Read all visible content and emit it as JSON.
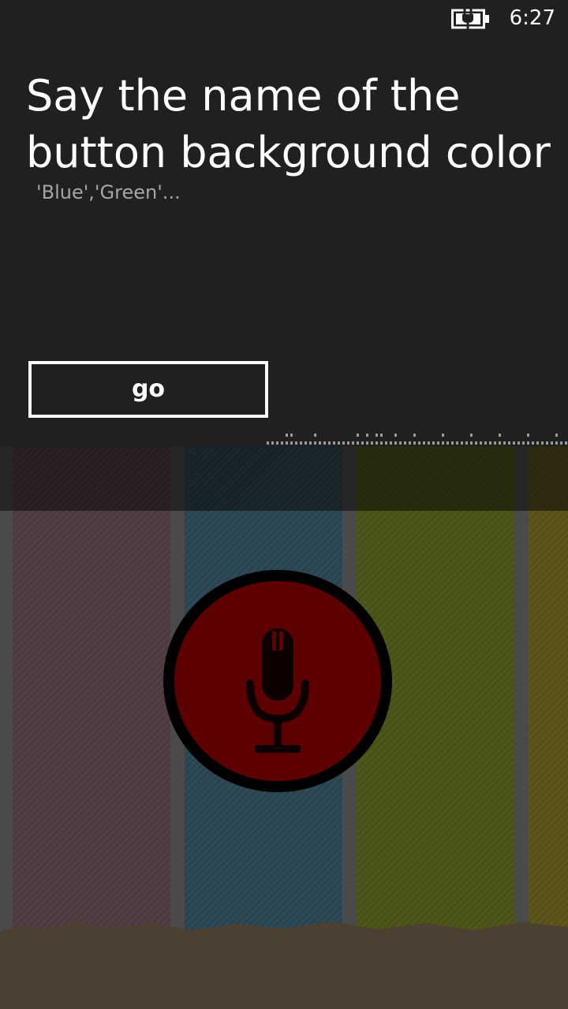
{
  "status_bar": {
    "time": "6:27",
    "battery_icon": "battery-charging-icon"
  },
  "prompt": {
    "title_line1": "Say the name of the",
    "title_line2": "button background color",
    "hint": "'Blue','Green'..."
  },
  "go_button": {
    "label": "go"
  },
  "microphone": {
    "icon": "microphone-icon",
    "color": "#5c0000"
  },
  "colors": {
    "panel_background": "#202020",
    "text": "#ffffff",
    "hint_text": "#a6a6a6"
  }
}
